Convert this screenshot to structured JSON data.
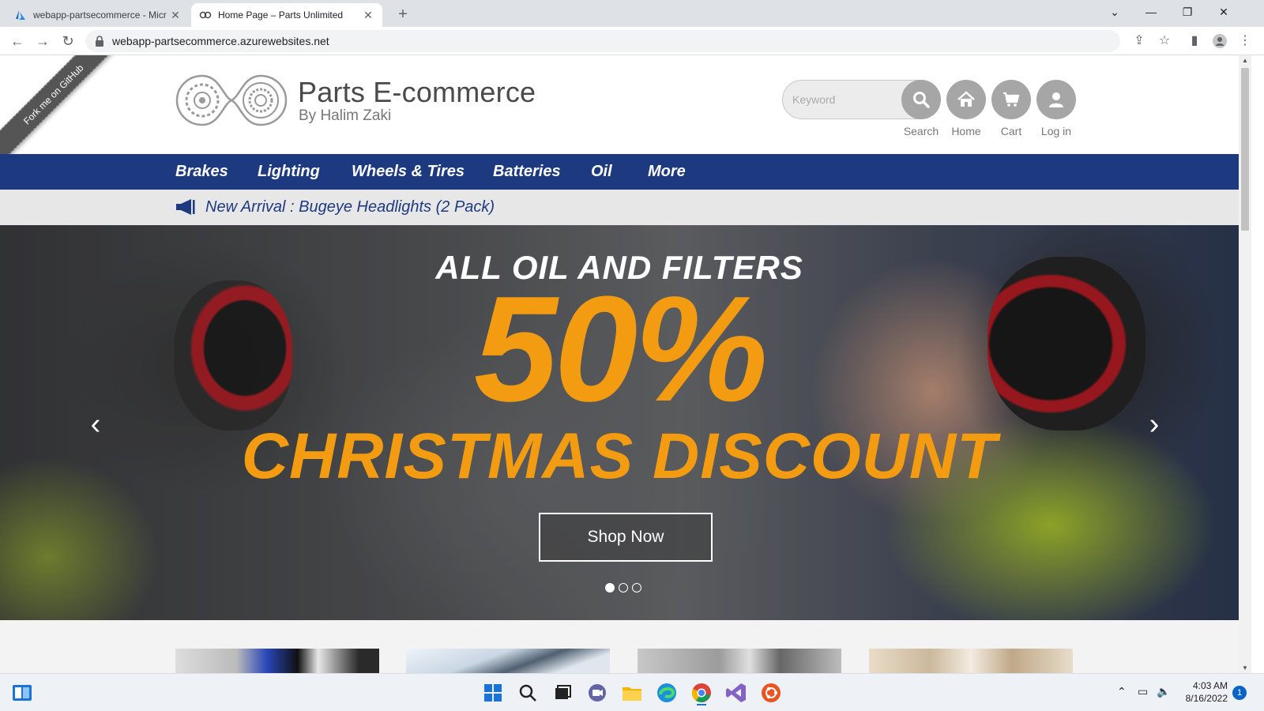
{
  "browser": {
    "tabs": [
      {
        "title": "webapp-partsecommerce - Micr",
        "active": false,
        "icon": "azure-icon"
      },
      {
        "title": "Home Page – Parts Unlimited",
        "active": true,
        "icon": "link-icon"
      }
    ],
    "url": "webapp-partsecommerce.azurewebsites.net"
  },
  "site": {
    "ribbon": "Fork me on GitHub",
    "brand_title": "Parts E-commerce",
    "brand_subtitle": "By Halim Zaki",
    "search_placeholder": "Keyword",
    "header_buttons": [
      {
        "label": "Search",
        "icon": "search-icon"
      },
      {
        "label": "Home",
        "icon": "home-icon"
      },
      {
        "label": "Cart",
        "icon": "cart-icon"
      },
      {
        "label": "Log in",
        "icon": "user-icon"
      }
    ],
    "categories": [
      "Brakes",
      "Lighting",
      "Wheels & Tires",
      "Batteries",
      "Oil",
      "More"
    ],
    "new_arrival": "New Arrival : Bugeye Headlights (2 Pack)",
    "hero": {
      "line1": "ALL OIL AND FILTERS",
      "big": "50%",
      "line3": "CHRISTMAS DISCOUNT",
      "button": "Shop Now",
      "slides": 3,
      "active_slide": 1
    }
  },
  "taskbar": {
    "time": "4:03 AM",
    "date": "8/16/2022",
    "notifications": "1"
  },
  "colors": {
    "nav_blue": "#1d3a80",
    "accent_orange": "#f39c12",
    "button_gray": "#a6a6a6"
  }
}
